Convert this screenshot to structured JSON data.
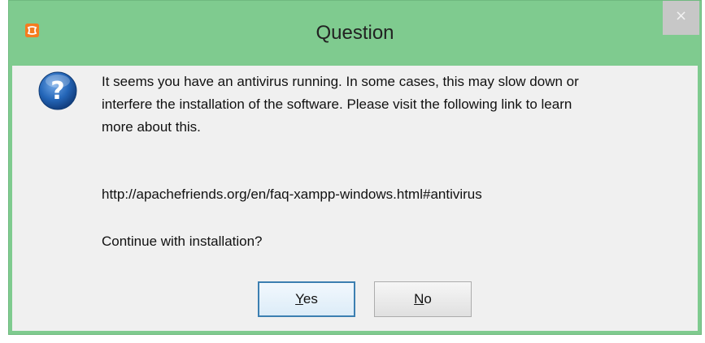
{
  "window": {
    "title": "Question",
    "app_icon_glyph": "ꟷ",
    "close_glyph": "×"
  },
  "message": {
    "line1": "It seems you have an antivirus running. In some cases, this may slow down or",
    "line2": "interfere the installation of the software. Please visit the following link to learn",
    "line3": "more about this.",
    "url": "http://apachefriends.org/en/faq-xampp-windows.html#antivirus",
    "question": "Continue with installation?"
  },
  "buttons": {
    "yes_mnemonic": "Y",
    "yes_rest": "es",
    "no_mnemonic": "N",
    "no_rest": "o"
  },
  "icons": {
    "app": "xampp-logo-icon",
    "dialog": "question-icon",
    "close": "close-icon"
  },
  "colors": {
    "frame": "#7fcb8f",
    "client_bg": "#f0f0f0",
    "app_icon": "#f57c1f",
    "question_icon": "#1f5ca8",
    "default_button_border": "#3c7fb1"
  }
}
